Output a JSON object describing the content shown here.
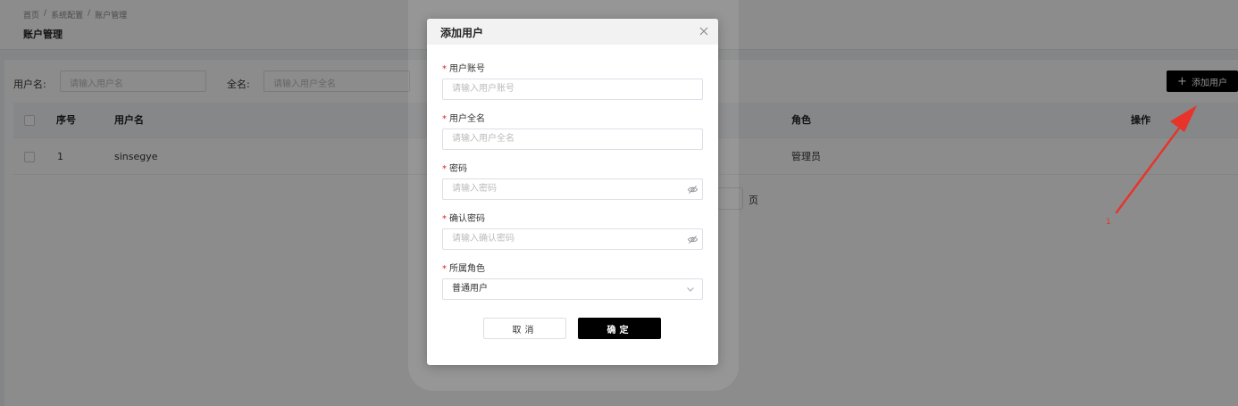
{
  "breadcrumb": [
    "首页",
    "/",
    "系统配置",
    "/",
    "账户管理"
  ],
  "page_title": "账户管理",
  "search": {
    "username_label": "用户名:",
    "username_placeholder": "请输入用户名",
    "fullname_label": "全名:",
    "fullname_placeholder": "请输入用户全名"
  },
  "add_button": {
    "icon": "plus-icon",
    "label": "添加用户"
  },
  "table": {
    "headers": {
      "index": "序号",
      "username": "用户名",
      "role": "角色",
      "actions": "操作"
    },
    "rows": [
      {
        "index": "1",
        "username": "sinsegye",
        "role": "管理员"
      }
    ]
  },
  "pagination": {
    "suffix": "页"
  },
  "modal": {
    "title": "添加用户",
    "required_mark": "*",
    "fields": {
      "account": {
        "label": "用户账号",
        "placeholder": "请输入用户账号"
      },
      "fullname": {
        "label": "用户全名",
        "placeholder": "请输入用户全名"
      },
      "password": {
        "label": "密码",
        "placeholder": "请输入密码",
        "icon": "eye-off-icon"
      },
      "confirm": {
        "label": "确认密码",
        "placeholder": "请输入确认密码",
        "icon": "eye-off-icon"
      },
      "role": {
        "label": "所属角色",
        "value": "普通用户",
        "icon": "chevron-down-icon"
      }
    },
    "cancel_label": "取消",
    "ok_label": "确定"
  },
  "annotation": {
    "number": "1",
    "color": "#e8332a"
  },
  "colors": {
    "primary": "#000000",
    "required": "#e02020",
    "overlay": "rgba(0,0,0,0.45)"
  }
}
